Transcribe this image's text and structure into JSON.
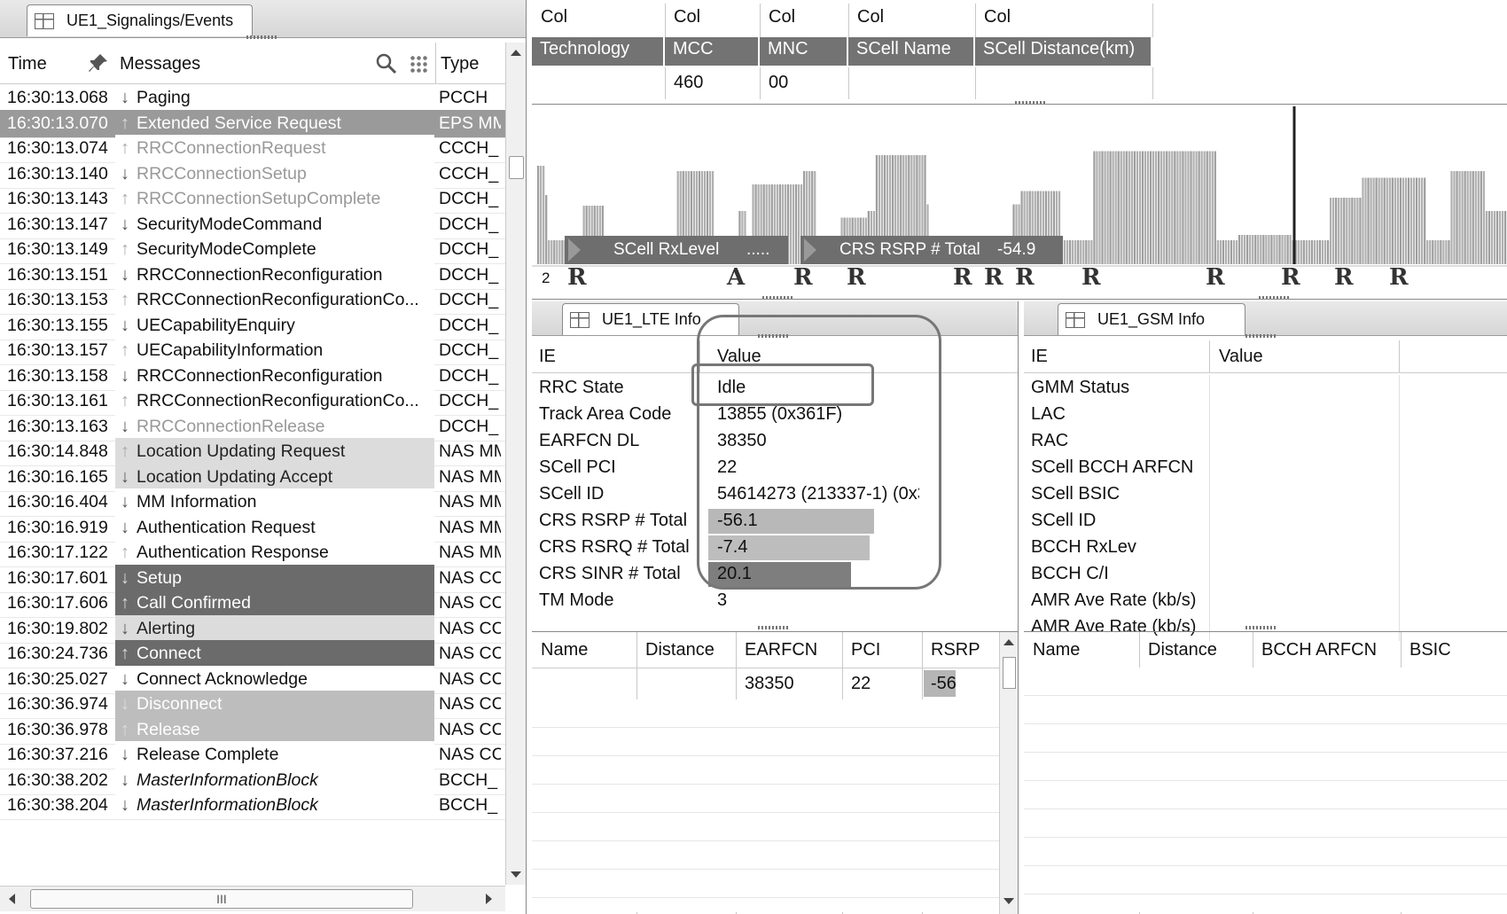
{
  "events_panel": {
    "tab_title": "UE1_Signalings/Events",
    "headers": {
      "time": "Time",
      "messages": "Messages",
      "type": "Type"
    },
    "rows": [
      {
        "time": "16:30:13.068",
        "dir": "down",
        "msg": "Paging",
        "type": "PCCH",
        "style": "plain"
      },
      {
        "time": "16:30:13.070",
        "dir": "up",
        "msg": "Extended Service Request",
        "type": "EPS MM",
        "style": "sel"
      },
      {
        "time": "16:30:13.074",
        "dir": "up",
        "msg": "RRCConnectionRequest",
        "type": "CCCH_",
        "style": "gray"
      },
      {
        "time": "16:30:13.140",
        "dir": "down",
        "msg": "RRCConnectionSetup",
        "type": "CCCH_",
        "style": "gray"
      },
      {
        "time": "16:30:13.143",
        "dir": "up",
        "msg": "RRCConnectionSetupComplete",
        "type": "DCCH_",
        "style": "gray"
      },
      {
        "time": "16:30:13.147",
        "dir": "down",
        "msg": "SecurityModeCommand",
        "type": "DCCH_",
        "style": "plain"
      },
      {
        "time": "16:30:13.149",
        "dir": "up",
        "msg": "SecurityModeComplete",
        "type": "DCCH_",
        "style": "plain"
      },
      {
        "time": "16:30:13.151",
        "dir": "down",
        "msg": "RRCConnectionReconfiguration",
        "type": "DCCH_",
        "style": "plain"
      },
      {
        "time": "16:30:13.153",
        "dir": "up",
        "msg": "RRCConnectionReconfigurationCo...",
        "type": "DCCH_",
        "style": "plain"
      },
      {
        "time": "16:30:13.155",
        "dir": "down",
        "msg": "UECapabilityEnquiry",
        "type": "DCCH_",
        "style": "plain"
      },
      {
        "time": "16:30:13.157",
        "dir": "up",
        "msg": "UECapabilityInformation",
        "type": "DCCH_",
        "style": "plain"
      },
      {
        "time": "16:30:13.158",
        "dir": "down",
        "msg": "RRCConnectionReconfiguration",
        "type": "DCCH_",
        "style": "plain"
      },
      {
        "time": "16:30:13.161",
        "dir": "up",
        "msg": "RRCConnectionReconfigurationCo...",
        "type": "DCCH_",
        "style": "plain"
      },
      {
        "time": "16:30:13.163",
        "dir": "down",
        "msg": "RRCConnectionRelease",
        "type": "DCCH_",
        "style": "gray"
      },
      {
        "time": "16:30:14.848",
        "dir": "up",
        "msg": "Location Updating Request",
        "type": "NAS MM",
        "style": "light"
      },
      {
        "time": "16:30:16.165",
        "dir": "down",
        "msg": "Location Updating Accept",
        "type": "NAS MM",
        "style": "light"
      },
      {
        "time": "16:30:16.404",
        "dir": "down",
        "msg": "MM Information",
        "type": "NAS MM",
        "style": "plain"
      },
      {
        "time": "16:30:16.919",
        "dir": "down",
        "msg": "Authentication Request",
        "type": "NAS MM",
        "style": "plain"
      },
      {
        "time": "16:30:17.122",
        "dir": "up",
        "msg": "Authentication Response",
        "type": "NAS MM",
        "style": "plain"
      },
      {
        "time": "16:30:17.601",
        "dir": "down",
        "msg": "Setup",
        "type": "NAS CC",
        "style": "dark"
      },
      {
        "time": "16:30:17.606",
        "dir": "up",
        "msg": "Call Confirmed",
        "type": "NAS CC",
        "style": "dark"
      },
      {
        "time": "16:30:19.802",
        "dir": "down",
        "msg": "Alerting",
        "type": "NAS CC",
        "style": "light"
      },
      {
        "time": "16:30:24.736",
        "dir": "up",
        "msg": "Connect",
        "type": "NAS CC",
        "style": "dark"
      },
      {
        "time": "16:30:25.027",
        "dir": "down",
        "msg": "Connect Acknowledge",
        "type": "NAS CC",
        "style": "plain"
      },
      {
        "time": "16:30:36.974",
        "dir": "down",
        "msg": "Disconnect",
        "type": "NAS CC",
        "style": "mid"
      },
      {
        "time": "16:30:36.978",
        "dir": "up",
        "msg": "Release",
        "type": "NAS CC",
        "style": "mid"
      },
      {
        "time": "16:30:37.216",
        "dir": "down",
        "msg": "Release Complete",
        "type": "NAS CC",
        "style": "plain"
      },
      {
        "time": "16:30:38.202",
        "dir": "down",
        "msg": "MasterInformationBlock",
        "type": "BCCH_",
        "style": "italic"
      },
      {
        "time": "16:30:38.204",
        "dir": "down",
        "msg": "MasterInformationBlock",
        "type": "BCCH_",
        "style": "italic"
      }
    ],
    "hscroll_label": "III"
  },
  "cell_table": {
    "headers": [
      "Col",
      "Col",
      "Col",
      "Col",
      "Col"
    ],
    "subheaders": [
      "Technology",
      "MCC",
      "MNC",
      "SCell Name",
      "SCell Distance(km)"
    ],
    "values": [
      "",
      "460",
      "00",
      "",
      ""
    ]
  },
  "chart": {
    "label1": "SCell RxLevel",
    "label1_suffix": ".....",
    "label2": "CRS RSRP # Total",
    "label2_value": "-54.9",
    "counter": "2",
    "heights": [
      0.74,
      0.74,
      0.74,
      0.52,
      0.18,
      0.18,
      0.18,
      0.18,
      0.18,
      0.18,
      0.18,
      0.18,
      0.18,
      0.18,
      0.18,
      0.18,
      0.18,
      0.44,
      0.44,
      0.44,
      0.44,
      0.44,
      0.44,
      0.44,
      0.44,
      0.18,
      0.18,
      0.18,
      0.18,
      0.18,
      0.18,
      0.18,
      0.18,
      0.18,
      0.18,
      0.18,
      0.18,
      0.18,
      0.18,
      0.18,
      0.18,
      0.18,
      0.18,
      0.18,
      0.18,
      0.18,
      0.18,
      0.18,
      0.18,
      0.2,
      0.2,
      0.2,
      0.7,
      0.7,
      0.7,
      0.7,
      0.7,
      0.7,
      0.7,
      0.7,
      0.7,
      0.7,
      0.7,
      0.7,
      0.7,
      0.7,
      0.18,
      0.18,
      0.18,
      0.18,
      0.18,
      0.18,
      0.18,
      0.18,
      0.18,
      0.4,
      0.4,
      0.4,
      0.15,
      0.15,
      0.6,
      0.6,
      0.6,
      0.6,
      0.6,
      0.6,
      0.6,
      0.6,
      0.6,
      0.6,
      0.6,
      0.6,
      0.6,
      0.6,
      0.6,
      0.6,
      0.6,
      0.6,
      0.6,
      0.7,
      0.7,
      0.7,
      0.7,
      0.7,
      0.18,
      0.18,
      0.18,
      0.18,
      0.18,
      0.18,
      0.18,
      0.18,
      0.18,
      0.35,
      0.35,
      0.35,
      0.35,
      0.35,
      0.35,
      0.35,
      0.35,
      0.35,
      0.35,
      0.4,
      0.4,
      0.4,
      0.82,
      0.82,
      0.82,
      0.82,
      0.82,
      0.82,
      0.82,
      0.82,
      0.82,
      0.82,
      0.82,
      0.82,
      0.82,
      0.82,
      0.82,
      0.82,
      0.82,
      0.82,
      0.82,
      0.45,
      0.18,
      0.18,
      0.18,
      0.18,
      0.18,
      0.18,
      0.18,
      0.18,
      0.18,
      0.18,
      0.18,
      0.18,
      0.18,
      0.18,
      0.18,
      0.18,
      0.18,
      0.18,
      0.18,
      0.18,
      0.18,
      0.18,
      0.18,
      0.18,
      0.18,
      0.18,
      0.18,
      0.18,
      0.18,
      0.18,
      0.18,
      0.45,
      0.45,
      0.45,
      0.55,
      0.55,
      0.55,
      0.55,
      0.55,
      0.55,
      0.55,
      0.55,
      0.55,
      0.55,
      0.55,
      0.55,
      0.55,
      0.55,
      0.55,
      0.18,
      0.18,
      0.18,
      0.18,
      0.18,
      0.18,
      0.18,
      0.18,
      0.18,
      0.18,
      0.18,
      0.18,
      0.85,
      0.85,
      0.85,
      0.85,
      0.85,
      0.85,
      0.85,
      0.85,
      0.85,
      0.85,
      0.85,
      0.85,
      0.85,
      0.85,
      0.85,
      0.85,
      0.85,
      0.85,
      0.85,
      0.85,
      0.85,
      0.85,
      0.85,
      0.85,
      0.85,
      0.85,
      0.85,
      0.85,
      0.85,
      0.85,
      0.85,
      0.85,
      0.85,
      0.85,
      0.85,
      0.85,
      0.85,
      0.85,
      0.85,
      0.85,
      0.85,
      0.85,
      0.85,
      0.85,
      0.85,
      0.85,
      0.18,
      0.18,
      0.18,
      0.18,
      0.18,
      0.18,
      0.18,
      0.18,
      0.22,
      0.22,
      0.22,
      0.22,
      0.22,
      0.22,
      0.22,
      0.22,
      0.22,
      0.22,
      0.22,
      0.22,
      0.22,
      0.22,
      0.22,
      0.22,
      0.22,
      0.22,
      0.22,
      0.22,
      0.18,
      0.18,
      0.18,
      0.18,
      0.18,
      0.18,
      0.18,
      0.18,
      0.18,
      0.18,
      0.18,
      0.18,
      0.18,
      0.18,
      0.5,
      0.5,
      0.5,
      0.5,
      0.5,
      0.5,
      0.5,
      0.5,
      0.5,
      0.5,
      0.5,
      0.5,
      0.65,
      0.65,
      0.65,
      0.65,
      0.65,
      0.65,
      0.65,
      0.65,
      0.65,
      0.65,
      0.65,
      0.65,
      0.65,
      0.65,
      0.65,
      0.65,
      0.65,
      0.65,
      0.65,
      0.65,
      0.65,
      0.65,
      0.65,
      0.65,
      0.18,
      0.18,
      0.18,
      0.18,
      0.18,
      0.18,
      0.18,
      0.18,
      0.18,
      0.7,
      0.7,
      0.7,
      0.7,
      0.7,
      0.7,
      0.7,
      0.7,
      0.7,
      0.7,
      0.7,
      0.7,
      0.7,
      0.4,
      0.4,
      0.4,
      0.4,
      0.4,
      0.4,
      0.4,
      0.4
    ],
    "marks": [
      "R",
      "A",
      "R",
      "R",
      "R",
      "R",
      "R",
      "R",
      "R",
      "R",
      "R",
      "R"
    ]
  },
  "lte_panel": {
    "tab_title": "UE1_LTE Info",
    "headers": {
      "ie": "IE",
      "value": "Value"
    },
    "rows": [
      {
        "ie": "RRC State",
        "value": "Idle",
        "bar": 0,
        "shade": ""
      },
      {
        "ie": "Track Area Code",
        "value": "13855 (0x361F)",
        "bar": 0,
        "shade": ""
      },
      {
        "ie": "EARFCN DL",
        "value": "38350",
        "bar": 0,
        "shade": ""
      },
      {
        "ie": "SCell PCI",
        "value": "22",
        "bar": 0,
        "shade": ""
      },
      {
        "ie": "SCell ID",
        "value": "54614273 (213337-1) (0x3",
        "bar": 0,
        "shade": ""
      },
      {
        "ie": "CRS RSRP # Total",
        "value": "-56.1",
        "bar": 0.72,
        "shade": "#b8b8b8"
      },
      {
        "ie": "CRS RSRQ # Total",
        "value": "-7.4",
        "bar": 0.7,
        "shade": "#bdbdbd"
      },
      {
        "ie": "CRS SINR # Total",
        "value": "20.1",
        "bar": 0.62,
        "shade": "#7e7e7e"
      },
      {
        "ie": "TM Mode",
        "value": "3",
        "bar": 0,
        "shade": ""
      }
    ],
    "neighbors": {
      "headers": [
        "Name",
        "Distance",
        "EARFCN",
        "PCI",
        "RSRP"
      ],
      "row": [
        "",
        "",
        "38350",
        "22",
        "-56"
      ]
    }
  },
  "gsm_panel": {
    "tab_title": "UE1_GSM Info",
    "headers": {
      "ie": "IE",
      "value": "Value"
    },
    "rows": [
      "GMM Status",
      "LAC",
      "RAC",
      "SCell BCCH ARFCN",
      "SCell BSIC",
      "SCell ID",
      "BCCH RxLev",
      "BCCH C/I",
      "AMR Ave Rate (kb/s)",
      "AMR Ave Rate (kb/s)"
    ],
    "neighbors": {
      "headers": [
        "Name",
        "Distance",
        "BCCH ARFCN",
        "BSIC"
      ]
    }
  }
}
